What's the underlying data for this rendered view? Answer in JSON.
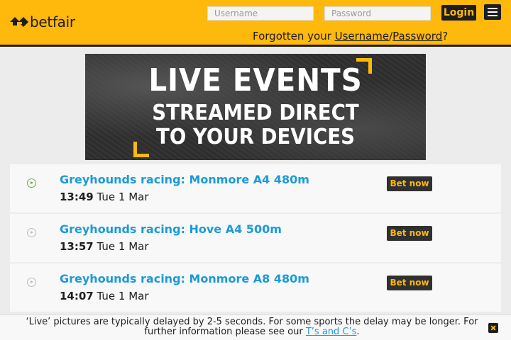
{
  "header": {
    "brand": "betfair",
    "username_placeholder": "Username",
    "password_placeholder": "Password",
    "login_label": "Login",
    "forgotten_prefix": "Forgotten your ",
    "forgotten_username": "Username",
    "forgotten_sep": "/",
    "forgotten_password": "Password",
    "forgotten_suffix": "?",
    "menu_icon": "hamburger-icon",
    "brand_color": "#ffb80c"
  },
  "banner": {
    "line1": "LIVE EVENTS",
    "line2": "STREAMED DIRECT",
    "line3": "TO YOUR DEVICES"
  },
  "events": [
    {
      "title": "Greyhounds racing: Monmore A4 480m",
      "time": "13:49",
      "date": "Tue 1 Mar",
      "action": "Bet now",
      "status_icon": "play-circle-icon",
      "live": true
    },
    {
      "title": "Greyhounds racing: Hove A4 500m",
      "time": "13:57",
      "date": "Tue 1 Mar",
      "action": "Bet now",
      "status_icon": "play-circle-icon",
      "live": false
    },
    {
      "title": "Greyhounds racing: Monmore A8 480m",
      "time": "14:07",
      "date": "Tue 1 Mar",
      "action": "Bet now",
      "status_icon": "play-circle-icon",
      "live": false
    }
  ],
  "notice": {
    "text": "‘Live’ pictures are typically delayed by 2-5 seconds. For some sports the delay may be longer. For further information please see our ",
    "link": "T’s and C’s",
    "end": "."
  }
}
